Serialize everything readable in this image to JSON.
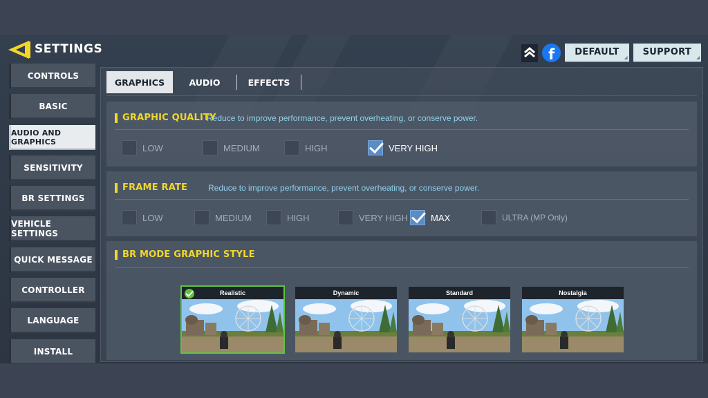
{
  "header": {
    "title": "SETTINGS",
    "default_label": "DEFAULT",
    "support_label": "SUPPORT"
  },
  "sidebar": {
    "items": [
      {
        "label": "CONTROLS",
        "active": false
      },
      {
        "label": "BASIC",
        "active": false
      },
      {
        "label": "AUDIO AND GRAPHICS",
        "active": true
      },
      {
        "label": "SENSITIVITY",
        "active": false
      },
      {
        "label": "BR SETTINGS",
        "active": false
      },
      {
        "label": "VEHICLE SETTINGS",
        "active": false
      },
      {
        "label": "QUICK MESSAGE",
        "active": false
      },
      {
        "label": "CONTROLLER",
        "active": false
      },
      {
        "label": "LANGUAGE",
        "active": false
      },
      {
        "label": "INSTALL",
        "active": false
      }
    ]
  },
  "tabs": [
    {
      "label": "GRAPHICS",
      "active": true
    },
    {
      "label": "AUDIO",
      "active": false
    },
    {
      "label": "EFFECTS",
      "active": false
    }
  ],
  "graphic_quality": {
    "title": "GRAPHIC QUALITY",
    "description": "Reduce to improve performance, prevent overheating, or conserve power.",
    "options": [
      {
        "label": "LOW",
        "checked": false
      },
      {
        "label": "MEDIUM",
        "checked": false
      },
      {
        "label": "HIGH",
        "checked": false
      },
      {
        "label": "VERY HIGH",
        "checked": true
      }
    ]
  },
  "frame_rate": {
    "title": "FRAME RATE",
    "description": "Reduce to improve performance, prevent overheating, or conserve power.",
    "options": [
      {
        "label": "LOW",
        "checked": false
      },
      {
        "label": "MEDIUM",
        "checked": false
      },
      {
        "label": "HIGH",
        "checked": false
      },
      {
        "label": "VERY HIGH",
        "checked": false
      },
      {
        "label": "MAX",
        "checked": true
      },
      {
        "label": "ULTRA (MP Only)",
        "checked": false
      }
    ]
  },
  "br_mode": {
    "title": "BR MODE GRAPHIC STYLE",
    "styles": [
      {
        "label": "Realistic",
        "selected": true
      },
      {
        "label": "Dynamic",
        "selected": false
      },
      {
        "label": "Standard",
        "selected": false
      },
      {
        "label": "Nostalgia",
        "selected": false
      }
    ]
  },
  "colors": {
    "accent_yellow": "#f2d72a",
    "check_blue": "#5b8cc4",
    "selected_green": "#5fc43c",
    "desc_blue": "#8fd0e8"
  }
}
